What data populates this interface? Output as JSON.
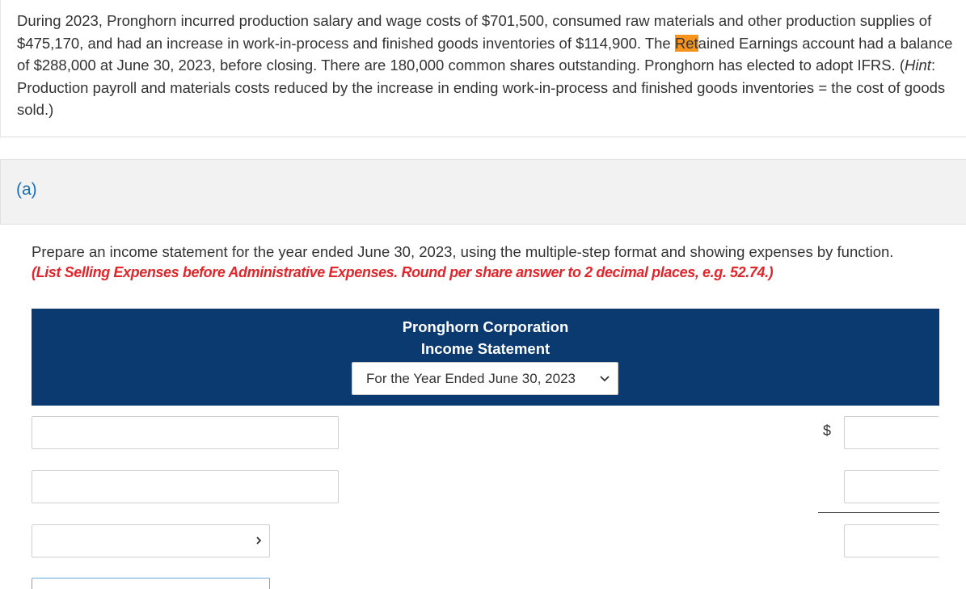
{
  "problem": {
    "line_start": "During 2023, Pronghorn incurred production salary and wage costs of $701,500, consumed raw materials and other production supplies of $475,170, and had an increase in work-in-process and finished goods inventories of $114,900. The ",
    "highlight": "Ret",
    "line_mid": "ained Earnings account had a balance of $288,000 at June 30, 2023, before closing. There are 180,000 common shares outstanding. Pronghorn has elected to adopt IFRS. (",
    "hint_label": "Hint",
    "line_end": ": Production payroll and materials costs reduced by the increase in ending work-in-process and finished goods inventories = the cost of goods sold.)"
  },
  "part": {
    "label": "(a)"
  },
  "instructions": {
    "main": "Prepare an income statement for the year ended June 30, 2023, using the multiple-step format and showing expenses by function.",
    "note": "(List Selling Expenses before Administrative Expenses. Round per share answer to 2 decimal places, e.g. 52.74.)"
  },
  "statement": {
    "company": "Pronghorn Corporation",
    "title": "Income Statement",
    "period_selected": "For the Year Ended June 30, 2023",
    "currency_symbol": "$"
  },
  "colors": {
    "header_bg": "#0b3a70",
    "highlight": "#f7941d",
    "part_label": "#1a6fb5",
    "note_red": "#e0252b"
  }
}
